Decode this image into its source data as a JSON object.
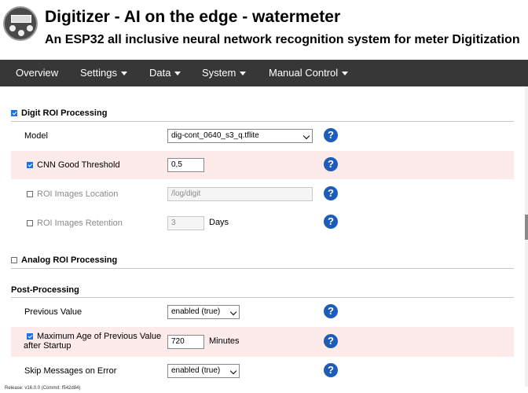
{
  "header": {
    "title": "Digitizer - AI on the edge - watermeter",
    "subtitle": "An ESP32 all inclusive neural network recognition system for meter Digitization"
  },
  "nav": [
    {
      "label": "Overview",
      "has_dropdown": false
    },
    {
      "label": "Settings",
      "has_dropdown": true
    },
    {
      "label": "Data",
      "has_dropdown": true
    },
    {
      "label": "System",
      "has_dropdown": true
    },
    {
      "label": "Manual Control",
      "has_dropdown": true
    }
  ],
  "digit_roi": {
    "section_label": "Digit ROI Processing",
    "enabled": true,
    "model": {
      "label": "Model",
      "value": "dig-cont_0640_s3_q.tflite"
    },
    "cnn_threshold": {
      "label": "CNN Good Threshold",
      "checked": true,
      "value": "0,5"
    },
    "images_location": {
      "label": "ROI Images Location",
      "checked": false,
      "value": "/log/digit"
    },
    "images_retention": {
      "label": "ROI Images Retention",
      "checked": false,
      "value": "3",
      "unit": "Days"
    }
  },
  "analog_roi": {
    "section_label": "Analog ROI Processing",
    "enabled": false
  },
  "post_processing": {
    "section_label": "Post-Processing",
    "previous_value": {
      "label": "Previous Value",
      "value": "enabled (true)"
    },
    "max_age": {
      "label_line1": "Maximum Age of Previous Value",
      "label_line2": "after Startup",
      "checked": true,
      "value": "720",
      "unit": "Minutes"
    },
    "skip_messages": {
      "label": "Skip Messages on Error",
      "value": "enabled (true)"
    }
  },
  "help_icon_glyph": "?",
  "footer": {
    "release": "Release: v16.0.0 (Commit: f542d84)"
  },
  "colors": {
    "nav_bg": "#373737",
    "pink_row": "#fdeaea",
    "help_icon": "#1d5db8",
    "checkbox_accent": "#1a73e8"
  }
}
